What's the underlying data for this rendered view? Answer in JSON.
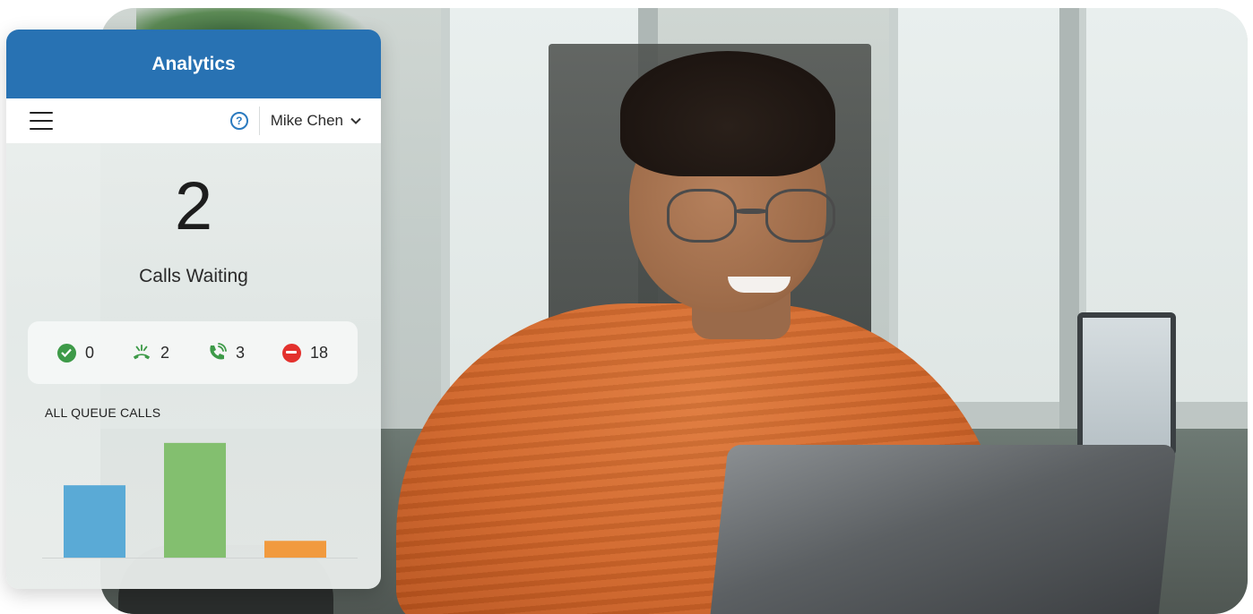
{
  "card": {
    "title": "Analytics",
    "user_name": "Mike Chen",
    "calls_waiting_count": "2",
    "calls_waiting_label": "Calls Waiting",
    "stats": [
      {
        "icon": "available-check-icon",
        "value": "0",
        "color": "#3d9a48"
      },
      {
        "icon": "missed-call-icon",
        "value": "2",
        "color": "#3d9a48"
      },
      {
        "icon": "active-call-icon",
        "value": "3",
        "color": "#3d9a48"
      },
      {
        "icon": "do-not-disturb-icon",
        "value": "18",
        "color": "#e3312d"
      }
    ],
    "chart_title": "ALL QUEUE CALLS"
  },
  "colors": {
    "header": "#2872b3",
    "bar_blue": "#5aaad6",
    "bar_green": "#83bf6f",
    "bar_orange": "#f19a3e"
  },
  "chart_data": {
    "type": "bar",
    "title": "ALL QUEUE CALLS",
    "categories": [
      "",
      "",
      ""
    ],
    "values": [
      82,
      130,
      19
    ],
    "colors": [
      "#5aaad6",
      "#83bf6f",
      "#f19a3e"
    ],
    "ylim": [
      0,
      140
    ],
    "grid": false
  }
}
